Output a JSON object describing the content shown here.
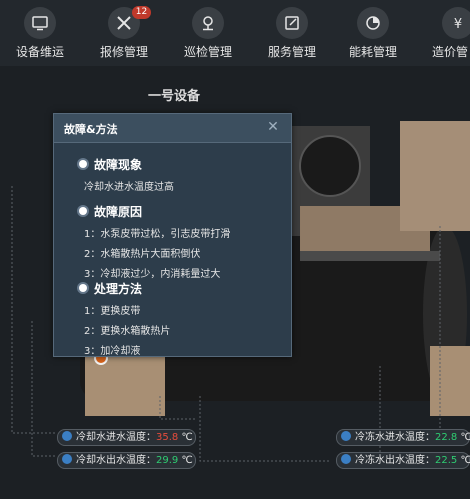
{
  "nav": {
    "items": [
      {
        "label": "设备维运",
        "icon": "monitor-icon"
      },
      {
        "label": "报修管理",
        "icon": "tools-icon",
        "badge": "12"
      },
      {
        "label": "巡检管理",
        "icon": "location-pin-icon"
      },
      {
        "label": "服务管理",
        "icon": "edit-icon"
      },
      {
        "label": "能耗管理",
        "icon": "pie-chart-icon"
      },
      {
        "label": "造价管",
        "icon": "money-icon"
      }
    ]
  },
  "equipment_title": "一号设备",
  "dialog": {
    "title": "故障&方法",
    "close_icon": "close-icon",
    "phenomenon": {
      "title": "故障现象",
      "lines": [
        "冷却水进水温度过高"
      ]
    },
    "cause": {
      "title": "故障原因",
      "lines": [
        "1：水泵皮带过松，引志皮带打滑",
        "2：水箱散热片大面积倒伏",
        "3：冷却液过少，内消耗量过大"
      ]
    },
    "method": {
      "title": "处理方法",
      "lines": [
        "1：更换皮带",
        "2：更换水箱散热片",
        "3：加冷却液"
      ]
    }
  },
  "temps": {
    "cool_in": {
      "label": "冷却水进水温度：",
      "value": "35.8",
      "unit": "℃"
    },
    "cool_out": {
      "label": "冷却水出水温度：",
      "value": "29.9",
      "unit": "℃"
    },
    "chill_in": {
      "label": "冷冻水进水温度：",
      "value": "22.8",
      "unit": "℃"
    },
    "chill_out": {
      "label": "冷冻水出水温度：",
      "value": "22.5",
      "unit": "℃"
    }
  },
  "colors": {
    "alarm": "#e74c3c",
    "normal": "#2ecc71",
    "accent": "#3b7fc4"
  }
}
